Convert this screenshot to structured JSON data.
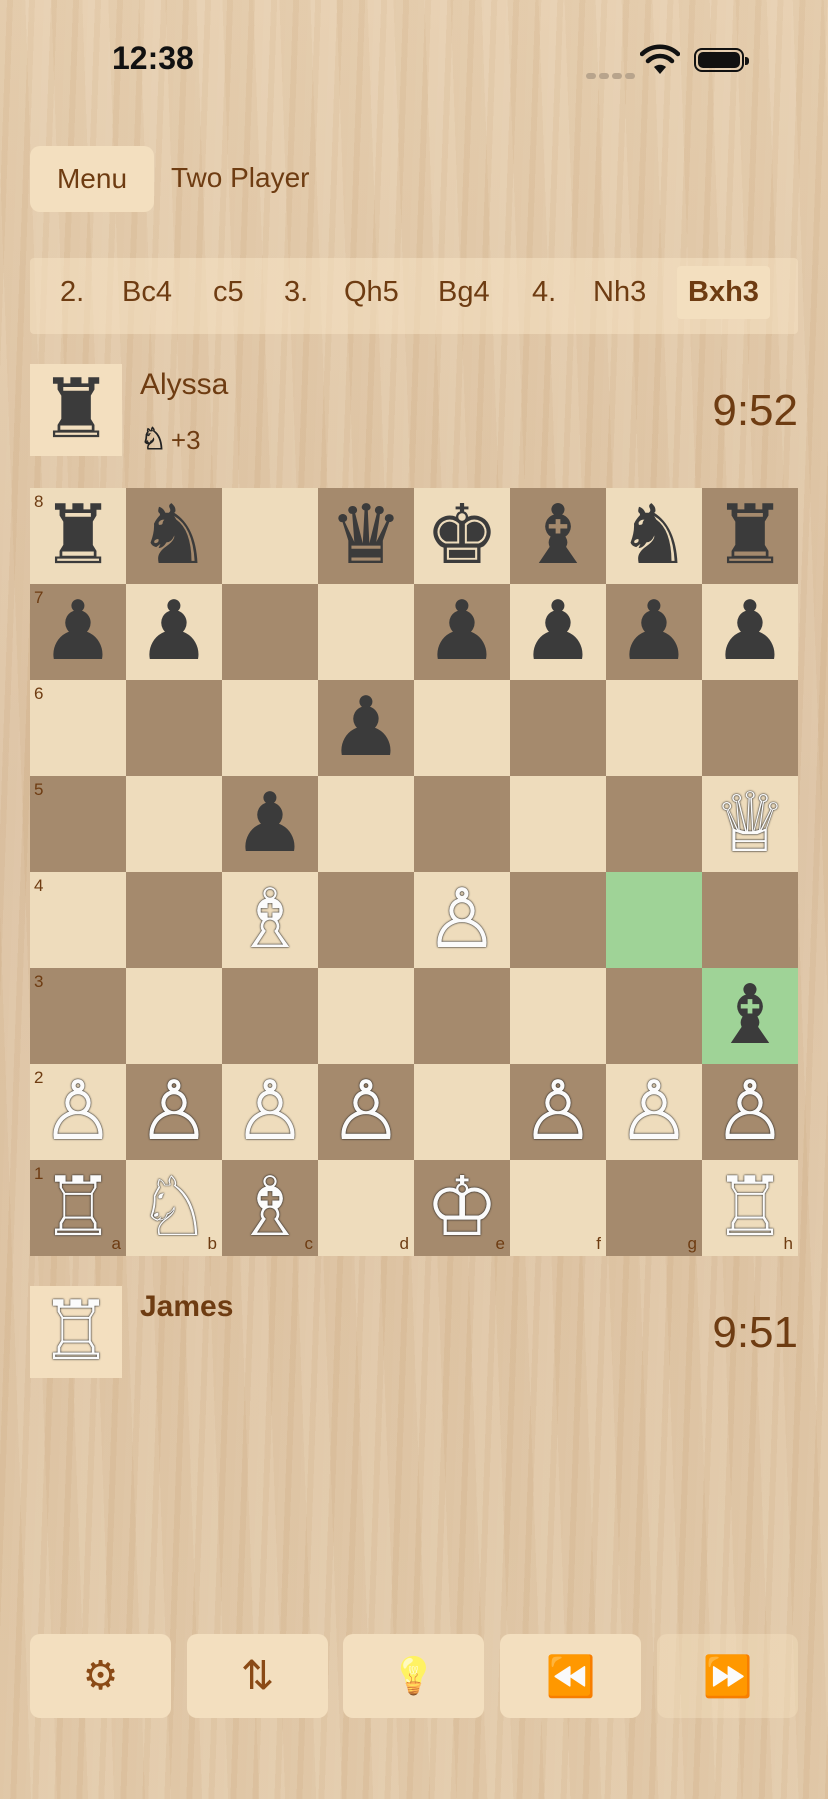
{
  "status": {
    "time": "12:38"
  },
  "header": {
    "menu_label": "Menu",
    "mode_label": "Two Player"
  },
  "moves": [
    {
      "text": "2.",
      "current": false
    },
    {
      "text": "Bc4",
      "current": false
    },
    {
      "text": "c5",
      "current": false
    },
    {
      "text": "3.",
      "current": false
    },
    {
      "text": "Qh5",
      "current": false
    },
    {
      "text": "Bg4",
      "current": false
    },
    {
      "text": "4.",
      "current": false
    },
    {
      "text": "Nh3",
      "current": false
    },
    {
      "text": "Bxh3",
      "current": true
    }
  ],
  "top_player": {
    "name": "Alyssa",
    "clock": "9:52",
    "captured_piece": "♘",
    "material": "+3",
    "avatar_piece": "♜"
  },
  "bottom_player": {
    "name": "James",
    "clock": "9:51",
    "avatar_piece": "♖"
  },
  "board": {
    "ranks": [
      "8",
      "7",
      "6",
      "5",
      "4",
      "3",
      "2",
      "1"
    ],
    "files": [
      "a",
      "b",
      "c",
      "d",
      "e",
      "f",
      "g",
      "h"
    ],
    "highlighted": [
      "g4",
      "h3"
    ],
    "position": [
      [
        "♜",
        "♞",
        "",
        "♛",
        "♚",
        "♝",
        "♞",
        "♜"
      ],
      [
        "♟",
        "♟",
        "",
        "",
        "♟",
        "♟",
        "♟",
        "♟"
      ],
      [
        "",
        "",
        "",
        "♟",
        "",
        "",
        "",
        ""
      ],
      [
        "",
        "",
        "♟",
        "",
        "",
        "",
        "",
        "♕"
      ],
      [
        "",
        "",
        "♗",
        "",
        "♙",
        "",
        "",
        ""
      ],
      [
        "",
        "",
        "",
        "",
        "",
        "",
        "",
        "♝"
      ],
      [
        "♙",
        "♙",
        "♙",
        "♙",
        "",
        "♙",
        "♙",
        "♙"
      ],
      [
        "♖",
        "♘",
        "♗",
        "",
        "♔",
        "",
        "",
        "♖"
      ]
    ]
  },
  "toolbar": [
    {
      "name": "settings-button",
      "icon": "gear-icon",
      "glyph": "⚙",
      "enabled": true
    },
    {
      "name": "flip-board-button",
      "icon": "flip-icon",
      "glyph": "⇅",
      "enabled": true
    },
    {
      "name": "hint-button",
      "icon": "lightbulb-icon",
      "glyph": "💡",
      "enabled": true
    },
    {
      "name": "rewind-button",
      "icon": "rewind-icon",
      "glyph": "⏪",
      "enabled": true
    },
    {
      "name": "forward-button",
      "icon": "fast-forward-icon",
      "glyph": "⏩",
      "enabled": false
    }
  ],
  "colors": {
    "accent": "#6e3c12",
    "light_square": "#eedcbc",
    "dark_square": "#a58a6d",
    "highlight": "#9fd397",
    "button_bg": "#f3dfbf"
  }
}
